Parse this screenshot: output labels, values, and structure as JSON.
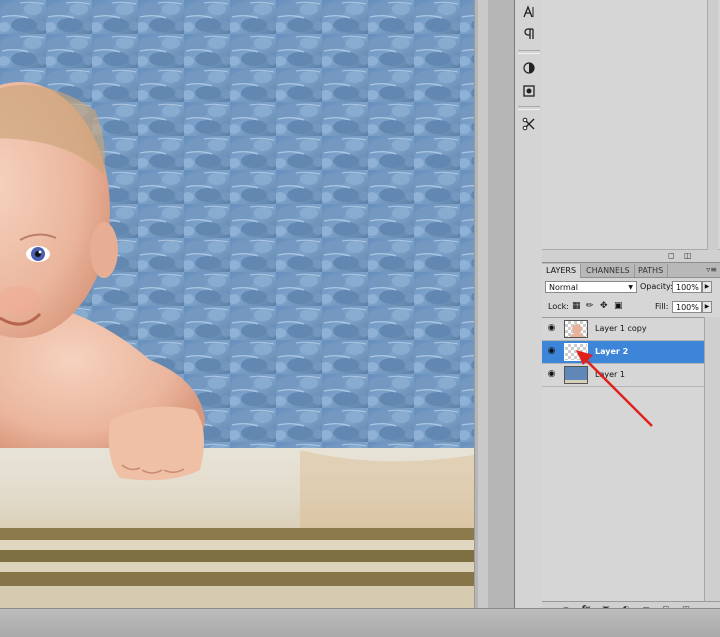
{
  "layers_panel": {
    "tabs": [
      "LAYERS",
      "CHANNELS",
      "PATHS"
    ],
    "menu_icon": "panel-menu-icon",
    "blend_mode": "Normal",
    "opacity_label": "Opacity:",
    "opacity_value": "100%",
    "lock_label": "Lock:",
    "fill_label": "Fill:",
    "fill_value": "100%",
    "layers": [
      {
        "name": "Layer 1 copy",
        "selected": false,
        "thumb": "baby-cutout"
      },
      {
        "name": "Layer 2",
        "selected": true,
        "thumb": "transparent"
      },
      {
        "name": "Layer 1",
        "selected": false,
        "thumb": "water"
      }
    ],
    "footer_icons": [
      "link-icon",
      "fx-icon",
      "mask-icon",
      "adjustment-icon",
      "group-icon",
      "new-layer-icon",
      "trash-icon"
    ]
  },
  "tool_strip": {
    "icons": [
      "character-icon",
      "paragraph-icon",
      "brush-preset-icon",
      "clone-source-icon",
      "tool-preset-icon"
    ]
  },
  "colors": {
    "selection": "#3d85d8",
    "panel": "#d6d6d6",
    "arrow": "#e0201c"
  }
}
